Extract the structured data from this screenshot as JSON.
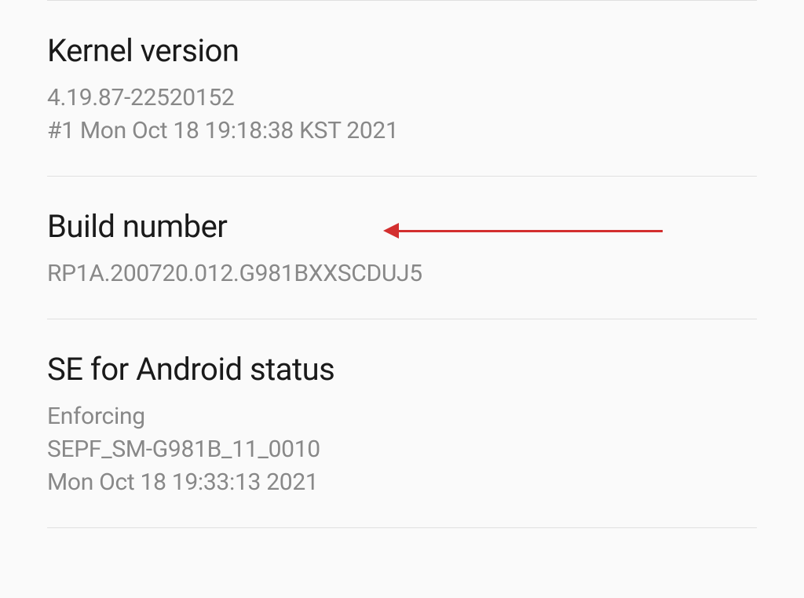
{
  "kernel": {
    "title": "Kernel version",
    "line1": "4.19.87-22520152",
    "line2": "#1 Mon Oct 18 19:18:38 KST 2021"
  },
  "build": {
    "title": "Build number",
    "value": "RP1A.200720.012.G981BXXSCDUJ5"
  },
  "se_android": {
    "title": "SE for Android status",
    "line1": "Enforcing",
    "line2": "SEPF_SM-G981B_11_0010",
    "line3": "Mon Oct 18 19:33:13 2021"
  }
}
